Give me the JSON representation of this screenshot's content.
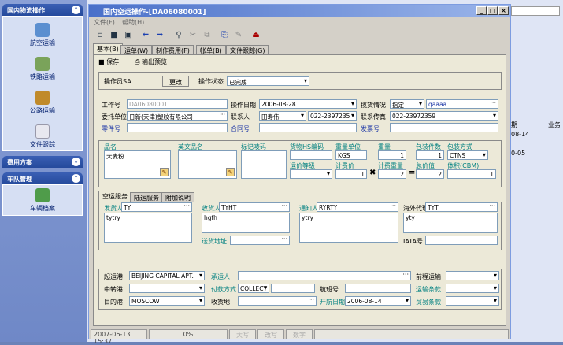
{
  "sidebar": {
    "sections": [
      {
        "title": "国内物流操作",
        "toggle": "⌃",
        "items": [
          {
            "label": "航空运输",
            "icon": "airplane-icon"
          },
          {
            "label": "铁路运输",
            "icon": "train-icon"
          },
          {
            "label": "公路运输",
            "icon": "truck-icon"
          },
          {
            "label": "文件跟踪",
            "icon": "document-icon"
          }
        ]
      },
      {
        "title": "费用方案",
        "toggle": "⌄"
      },
      {
        "title": "车队管理",
        "toggle": "⌃",
        "items": [
          {
            "label": "车辆档案",
            "icon": "vehicle-icon"
          }
        ]
      }
    ]
  },
  "background": {
    "col1": "期",
    "col2": "业务",
    "rows": [
      "08-14",
      "0-05"
    ]
  },
  "window": {
    "title": "国内空运操作-[DA06080001]",
    "menu": [
      "文件(F)",
      "帮助(H)"
    ],
    "tabs": [
      "基本(B)",
      "运单(W)",
      "制作费用(F)",
      "帐单(B)",
      "文件跟踪(G)"
    ],
    "save": "保存",
    "preview": "输出预览",
    "operator_label": "操作员",
    "operator_value": "SA",
    "change_btn": "更改",
    "status_label": "操作状态",
    "status_value": "已完成",
    "job_no_label": "工作号",
    "job_no": "DA06080001",
    "op_date_label": "操作日期",
    "op_date": "2006-08-28",
    "pickup_label": "揽货情况",
    "pickup_value": "指定",
    "pickup_extra": "qaaaa",
    "client_label": "委托单位",
    "client": "日新(天津)塑胶有限公司",
    "contact_label": "联系人",
    "contact": "田寿伟",
    "contact_phone": "022-2397235",
    "fax_label": "联系传真",
    "fax": "022-23972359",
    "part_label": "零件号",
    "contract_label": "合同号",
    "invoice_label": "发票号",
    "cargo": {
      "name_label": "品名",
      "name": "大麦粉",
      "en_name_label": "英文品名",
      "mark_label": "标记唛码",
      "hs_label": "货物HS编码",
      "unit_label": "重量单位",
      "unit": "KGS",
      "weight_label": "重量",
      "weight": "1",
      "pieces_label": "包装件数",
      "pieces": "1",
      "pack_label": "包装方式",
      "pack": "CTNS",
      "grade_label": "运价等级",
      "cwt_label": "计费价",
      "cwt": "1",
      "chg_label": "计费重量",
      "chg": "2",
      "total_label": "总价值",
      "total": "2",
      "vol_label": "体积(CBM)",
      "vol": "1"
    },
    "subtabs": [
      "空运服务",
      "陆运服务",
      "附加说明"
    ],
    "shipper_label": "发货人",
    "shipper": "TY",
    "shipper_text": "tytry",
    "consignee_label": "收货人",
    "consignee": "TYHT",
    "consignee_text": "hgfh",
    "notify_label": "通知人",
    "notify": "RYRTY",
    "notify_text": "ytry",
    "agent_label": "海外代理",
    "agent": "TYT",
    "agent_text": "yty",
    "delivery_label": "送货地址",
    "iata_label": "IATA号",
    "origin_label": "起运港",
    "origin": "BEIJING CAPITAL APT.",
    "carrier_label": "承运人",
    "pre_label": "前程运输",
    "transit_label": "中转港",
    "payment_label": "付款方式",
    "payment": "COLLECT",
    "flight_label": "航班号",
    "transport_terms_label": "运输条款",
    "dest_label": "目的港",
    "dest": "MOSCOW",
    "receipt_label": "收货地",
    "sail_label": "开航日期",
    "sail": "2006-08-14",
    "trade_label": "贸易条款",
    "statusbar": {
      "time": "2007-06-13 15:37",
      "pct": "0%",
      "caps": "大写",
      "ins": "改写",
      "num": "数字"
    }
  }
}
